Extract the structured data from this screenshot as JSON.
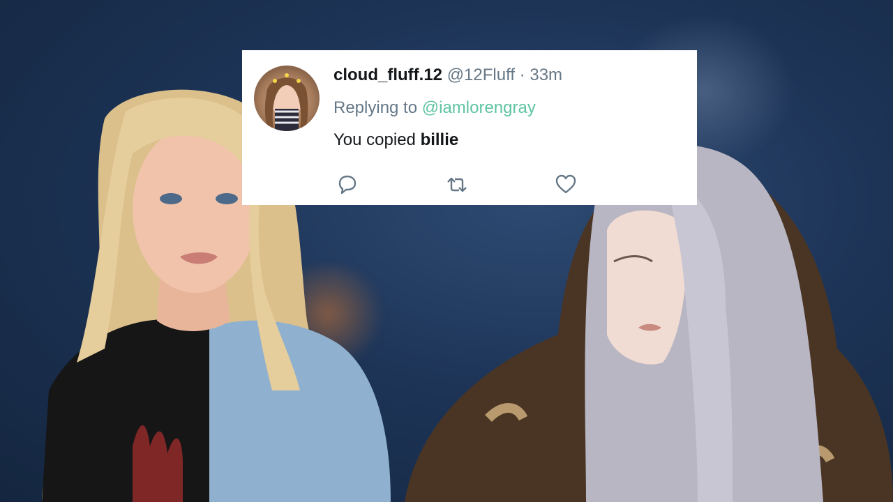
{
  "tweet": {
    "display_name": "cloud_fluff.12",
    "handle": "@12Fluff",
    "separator": "·",
    "time": "33m",
    "replying_prefix": "Replying to",
    "replying_to": "@iamlorengray",
    "text_prefix": "You copied",
    "text_bold": "billie",
    "actions": {
      "reply_icon": "reply-icon",
      "retweet_icon": "retweet-icon",
      "like_icon": "heart-icon"
    }
  },
  "colors": {
    "background": "#1d3457",
    "link": "#5ec4a0",
    "muted": "#657786",
    "text": "#14171a"
  }
}
